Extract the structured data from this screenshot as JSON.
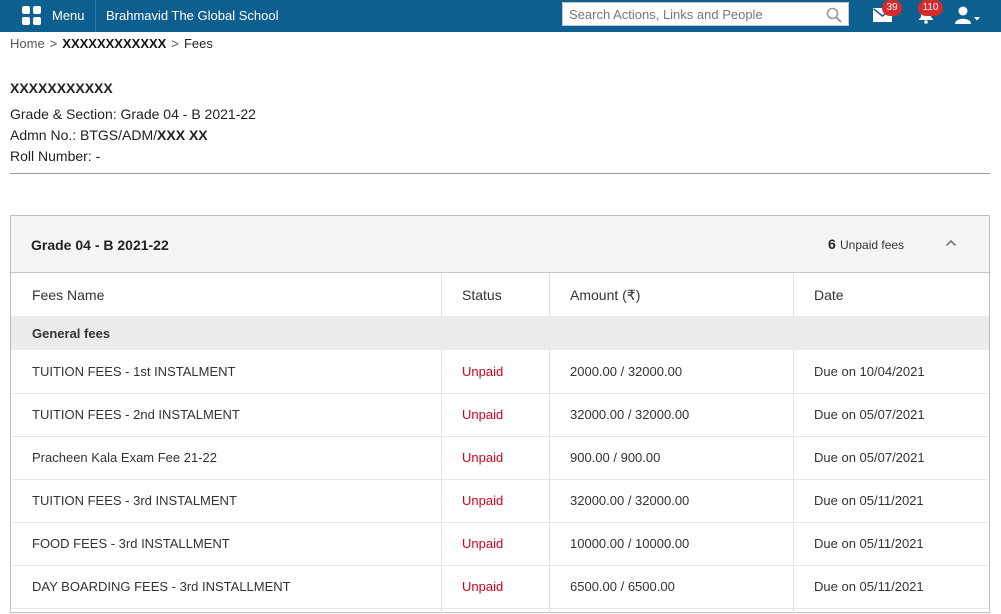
{
  "topbar": {
    "menu_label": "Menu",
    "school_name": "Brahmavid The Global School",
    "search_placeholder": "Search Actions, Links and People",
    "mail_count": "39",
    "notification_count": "110"
  },
  "breadcrumb": {
    "home": "Home",
    "separator": ">",
    "masked": "XXXXXXXXXXXX",
    "current": "Fees"
  },
  "student": {
    "name": "XXXXXXXXXXX",
    "grade_section": "Grade & Section: Grade 04 - B 2021-22",
    "admn_prefix": "Admn No.: BTGS/ADM/",
    "admn_masked": "XXX XX",
    "roll_number": "Roll Number: -"
  },
  "panel": {
    "title": "Grade 04 - B 2021-22",
    "unpaid_count": "6",
    "unpaid_label": "Unpaid fees"
  },
  "table": {
    "headers": [
      "Fees Name",
      "Status",
      "Amount (₹)",
      "Date"
    ],
    "group_label": "General fees",
    "rows": [
      {
        "name": "TUITION FEES - 1st INSTALMENT",
        "status": "Unpaid",
        "amount": "2000.00 / 32000.00",
        "date": "Due on 10/04/2021"
      },
      {
        "name": "TUITION FEES - 2nd INSTALMENT",
        "status": "Unpaid",
        "amount": "32000.00 / 32000.00",
        "date": "Due on 05/07/2021"
      },
      {
        "name": "Pracheen Kala Exam Fee 21-22",
        "status": "Unpaid",
        "amount": "900.00 / 900.00",
        "date": "Due on 05/07/2021"
      },
      {
        "name": "TUITION FEES - 3rd INSTALMENT",
        "status": "Unpaid",
        "amount": "32000.00 / 32000.00",
        "date": "Due on 05/11/2021"
      },
      {
        "name": "FOOD FEES - 3rd INSTALLMENT",
        "status": "Unpaid",
        "amount": "10000.00 / 10000.00",
        "date": "Due on 05/11/2021"
      },
      {
        "name": "DAY BOARDING FEES - 3rd INSTALLMENT",
        "status": "Unpaid",
        "amount": "6500.00 / 6500.00",
        "date": "Due on 05/11/2021"
      }
    ]
  },
  "colors": {
    "topbar": "#0d5f8f",
    "unpaid": "#d0021b",
    "badge": "#d62b2b"
  }
}
